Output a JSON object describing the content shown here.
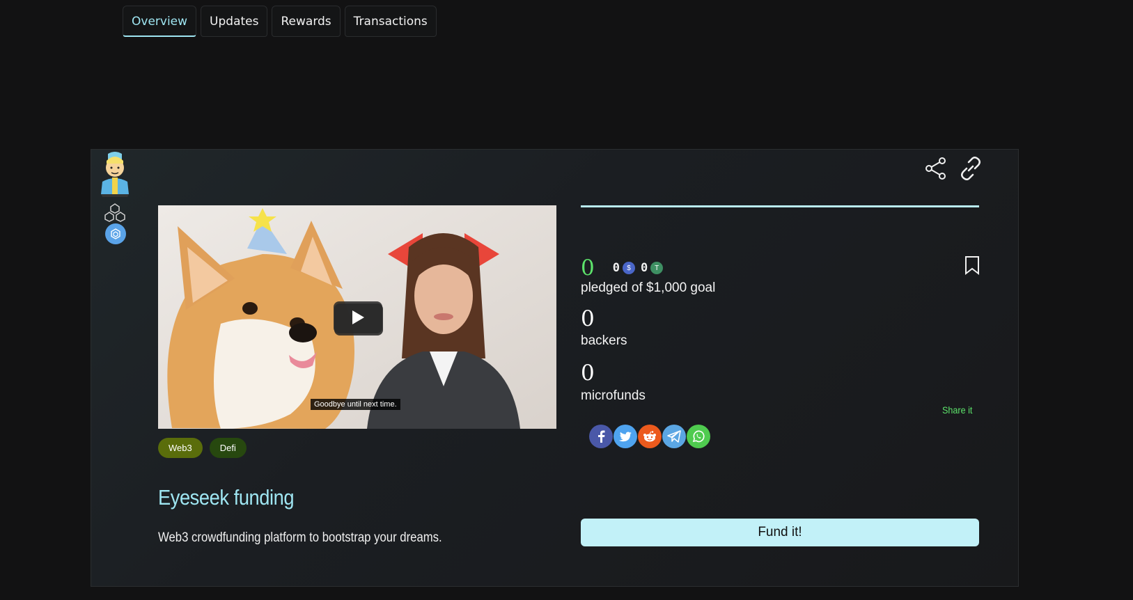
{
  "tabs": [
    {
      "label": "Overview",
      "active": true
    },
    {
      "label": "Updates",
      "active": false
    },
    {
      "label": "Rewards",
      "active": false
    },
    {
      "label": "Transactions",
      "active": false
    }
  ],
  "project": {
    "title": "Eyeseek funding",
    "description": "Web3 crowdfunding platform to bootstrap your dreams.",
    "tags": [
      "Web3",
      "Defi"
    ],
    "video_caption": "Goodbye until next time.",
    "progress_fraction": 0
  },
  "stats": {
    "pledged_total": "0",
    "usdc_amount": "0",
    "usdt_amount": "0",
    "pledged_label": "pledged of $1,000 goal",
    "backers_count": "0",
    "backers_label": "backers",
    "microfunds_count": "0",
    "microfunds_label": "microfunds"
  },
  "share": {
    "label": "Share it",
    "networks": [
      "facebook",
      "twitter",
      "reddit",
      "telegram",
      "whatsapp"
    ]
  },
  "actions": {
    "fund_label": "Fund it!"
  },
  "icons": {
    "share": "share-icon",
    "link": "link-icon",
    "bookmark": "bookmark-icon",
    "chain": "polygon-chain-icon",
    "token": "token-badge-icon",
    "usdc": "usdc-icon",
    "usdt": "usdt-icon"
  },
  "colors": {
    "accent": "#9fe6f2",
    "green": "#5de36b",
    "fund_button": "#c2f1f8",
    "background": "#121213"
  }
}
